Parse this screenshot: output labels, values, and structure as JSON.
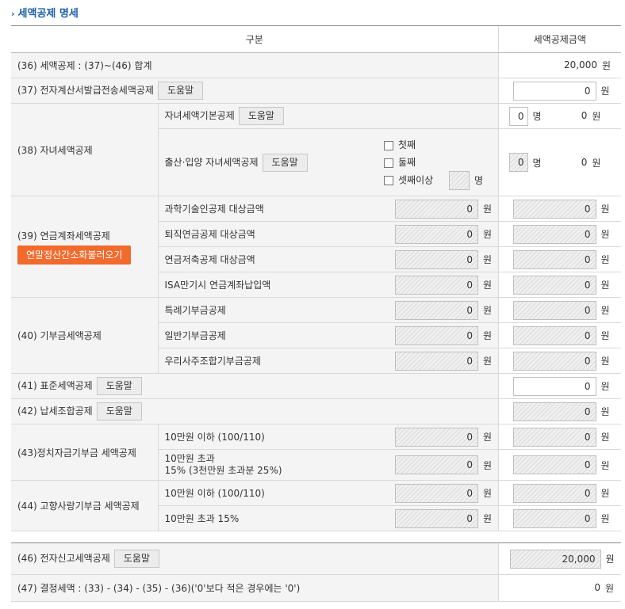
{
  "section_title": "세액공제 명세",
  "header": {
    "col1": "구분",
    "col2": "세액공제금액"
  },
  "unit_won": "원",
  "unit_person": "명",
  "help": "도움말",
  "row36": {
    "label": "(36) 세액공제 : (37)~(46) 합계",
    "value": "20,000"
  },
  "row37": {
    "label": "(37) 전자계산서발급전송세액공제",
    "value": "0"
  },
  "row38": {
    "label": "(38) 자녀세액공제",
    "basic_label": "자녀세액기본공제",
    "basic_count": "0",
    "basic_value": "0",
    "birth_label": "출산·입양 자녀세액공제",
    "birth_options": [
      "첫째",
      "둘째",
      "셋째이상"
    ],
    "birth_count": "0",
    "birth_value": "0"
  },
  "row39": {
    "label": "(39) 연금계좌세액공제",
    "load_button": "연말정산간소화불러오기",
    "items": [
      {
        "label": "과학기술인공제 대상금액",
        "base": "0",
        "value": "0"
      },
      {
        "label": "퇴직연금공제 대상금액",
        "base": "0",
        "value": "0"
      },
      {
        "label": "연금저축공제 대상금액",
        "base": "0",
        "value": "0"
      },
      {
        "label": "ISA만기시 연금계좌납입액",
        "base": "0",
        "value": "0"
      }
    ]
  },
  "row40": {
    "label": "(40) 기부금세액공제",
    "items": [
      {
        "label": "특례기부금공제",
        "base": "0",
        "value": "0"
      },
      {
        "label": "일반기부금공제",
        "base": "0",
        "value": "0"
      },
      {
        "label": "우리사주조합기부금공제",
        "base": "0",
        "value": "0"
      }
    ]
  },
  "row41": {
    "label": "(41) 표준세액공제",
    "value": "0"
  },
  "row42": {
    "label": "(42) 납세조합공제",
    "value": "0"
  },
  "row43": {
    "label": "(43)정치자금기부금 세액공제",
    "items": [
      {
        "label": "10만원 이하 (100/110)",
        "base": "0",
        "value": "0"
      },
      {
        "label1": "10만원 초과",
        "label2": "15% (3천만원 초과분 25%)",
        "base": "0",
        "value": "0"
      }
    ]
  },
  "row44": {
    "label": "(44) 고향사랑기부금 세액공제",
    "items": [
      {
        "label": "10만원 이하 (100/110)",
        "base": "0",
        "value": "0"
      },
      {
        "label": "10만원 초과 15%",
        "base": "0",
        "value": "0"
      }
    ]
  },
  "row46": {
    "label": "(46) 전자신고세액공제",
    "value": "20,000"
  },
  "row47": {
    "label": "(47) 결정세액 : (33) - (34) - (35) - (36)('0'보다 적은 경우에는 '0')",
    "value": "0"
  }
}
